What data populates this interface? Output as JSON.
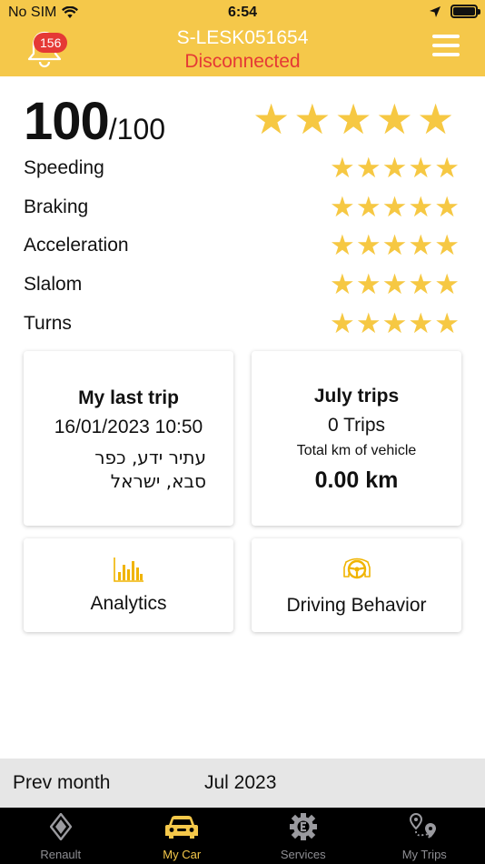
{
  "status_bar": {
    "carrier": "No SIM",
    "time": "6:54"
  },
  "header": {
    "notification_count": "156",
    "device_id": "S-LESK051654",
    "connection_status": "Disconnected"
  },
  "score": {
    "value": "100",
    "max": "/100",
    "stars": 5
  },
  "metrics": [
    {
      "label": "Speeding",
      "stars": 5
    },
    {
      "label": "Braking",
      "stars": 5
    },
    {
      "label": "Acceleration",
      "stars": 5
    },
    {
      "label": "Slalom",
      "stars": 5
    },
    {
      "label": "Turns",
      "stars": 5
    }
  ],
  "last_trip": {
    "title": "My last trip",
    "datetime": "16/01/2023 10:50",
    "address": "עתיר ידע, כפר סבא, ישראל"
  },
  "month_trips": {
    "title": "July trips",
    "trips": "0 Trips",
    "km_label": "Total km of vehicle",
    "km": "0.00 km"
  },
  "buttons": {
    "analytics": "Analytics",
    "driving_behavior": "Driving Behavior"
  },
  "month_bar": {
    "prev": "Prev month",
    "current": "Jul 2023"
  },
  "tabs": [
    {
      "label": "Renault",
      "icon": "renault-logo-icon"
    },
    {
      "label": "My Car",
      "icon": "car-icon"
    },
    {
      "label": "Services",
      "icon": "services-gear-icon"
    },
    {
      "label": "My Trips",
      "icon": "route-pin-icon"
    }
  ],
  "colors": {
    "accent": "#f5c84a",
    "star": "#f6c843",
    "alert": "#e53935"
  }
}
